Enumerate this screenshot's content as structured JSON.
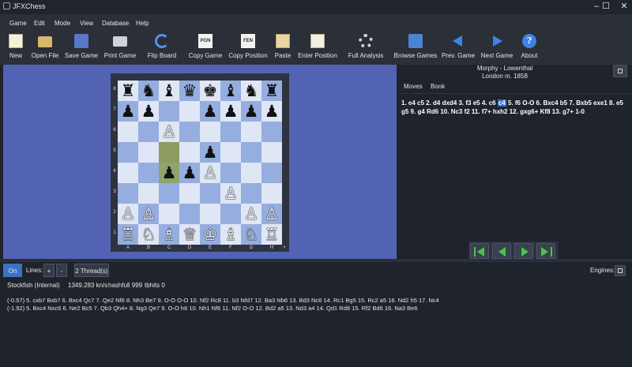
{
  "window": {
    "title": "JFXChess",
    "minimize": "–",
    "maximize": "☐",
    "close": "✕"
  },
  "menu": [
    "Game",
    "Edit",
    "Mode",
    "View",
    "Database",
    "Help"
  ],
  "toolbar": [
    {
      "label": "New",
      "icon": "new-document-icon"
    },
    {
      "label": "Open File",
      "icon": "folder-icon"
    },
    {
      "label": "Save Game",
      "icon": "save-icon"
    },
    {
      "label": "Print Game",
      "icon": "printer-icon"
    },
    {
      "label": "Flip Board",
      "icon": "flip-icon"
    },
    {
      "label": "Copy Game",
      "icon": "copy-pgn-icon",
      "glyph": "PGN"
    },
    {
      "label": "Copy Position",
      "icon": "copy-fen-icon",
      "glyph": "FEN"
    },
    {
      "label": "Paste",
      "icon": "clipboard-icon"
    },
    {
      "label": "Enter Position",
      "icon": "enter-position-icon"
    },
    {
      "label": "Full Analysis",
      "icon": "gear-icon"
    },
    {
      "label": "Browse Games",
      "icon": "books-icon"
    },
    {
      "label": "Prev. Game",
      "icon": "arrow-left-icon"
    },
    {
      "label": "Next Game",
      "icon": "arrow-right-icon"
    },
    {
      "label": "About",
      "icon": "info-icon",
      "glyph": "?"
    }
  ],
  "board": {
    "ranks": [
      "8",
      "7",
      "6",
      "5",
      "4",
      "3",
      "2",
      "1"
    ],
    "files": [
      "A",
      "B",
      "C",
      "D",
      "E",
      "F",
      "G",
      "H"
    ],
    "position": [
      [
        "r",
        "n",
        "b",
        "q",
        "k",
        "b",
        "n",
        "r"
      ],
      [
        "p",
        "p",
        "",
        "",
        "p",
        "p",
        "p",
        "p"
      ],
      [
        "",
        "",
        "P",
        "",
        "",
        "",
        "",
        ""
      ],
      [
        "",
        "",
        "",
        "",
        "p",
        "",
        "",
        ""
      ],
      [
        "",
        "",
        "p",
        "p",
        "P",
        "",
        "",
        ""
      ],
      [
        "",
        "",
        "",
        "",
        "",
        "P",
        "",
        ""
      ],
      [
        "P",
        "P",
        "",
        "",
        "",
        "",
        "P",
        "P"
      ],
      [
        "R",
        "N",
        "B",
        "Q",
        "K",
        "B",
        "N",
        "R"
      ]
    ],
    "highlighted": [
      "c5",
      "c4"
    ],
    "side_to_move_marker": "•"
  },
  "game": {
    "players": "Morphy - Lowenthal",
    "event": "London m. 1858",
    "tabs": [
      "Moves",
      "Book"
    ],
    "moves_before": "1. e4 c5 2. d4 dxd4 3. f3 e5 4. c6 ",
    "current_move": "c4",
    "moves_after": " 5. f6 O-O 6. Bxc4 b5 7. Bxb5 exe1 8. e5 g5 9. g4 Rd6 10. Nc3 f2 11. f7+ hxh2 12. gxg6+ Kf8 13. g7+ 1-0"
  },
  "engine": {
    "on_label": "On",
    "lines_label": "Lines:",
    "plus": "+",
    "minus": "-",
    "threads": "2 Thread(s)",
    "engines_label": "Engines:",
    "name": "Stockfish (Internal)",
    "speed": "1349.283 kn/s",
    "hashfull": "hashfull 999",
    "tbhits": "tbhits 0",
    "lines": [
      "(-0.57)  5. cxb7 Bxb7 6. Bxc4 Qc7 7. Qe2 Nf6 8. Nh3 Be7 9. O-O O-O 10. Nf2 Rc8 11. b3 Nfd7 12. Ba3 Nb6 13. Bd3 Nc6 14. Rc1 Bg5 15. Rc2 a5 16. Nd2 h5 17. Nc4",
      "(-1.92)  5. Bxc4 Nxc6 6. Ne2 Bc5 7. Qb3 Qh4+ 8. Ng3 Qe7 9. O-O h6 10. Nh1 Nf6 11. Nf2 O-O 12. Bd2 a5 13. Nd3 a4 14. Qd1 Rd8 15. Rf2 Bd6 16. Na3 Be6"
    ]
  }
}
